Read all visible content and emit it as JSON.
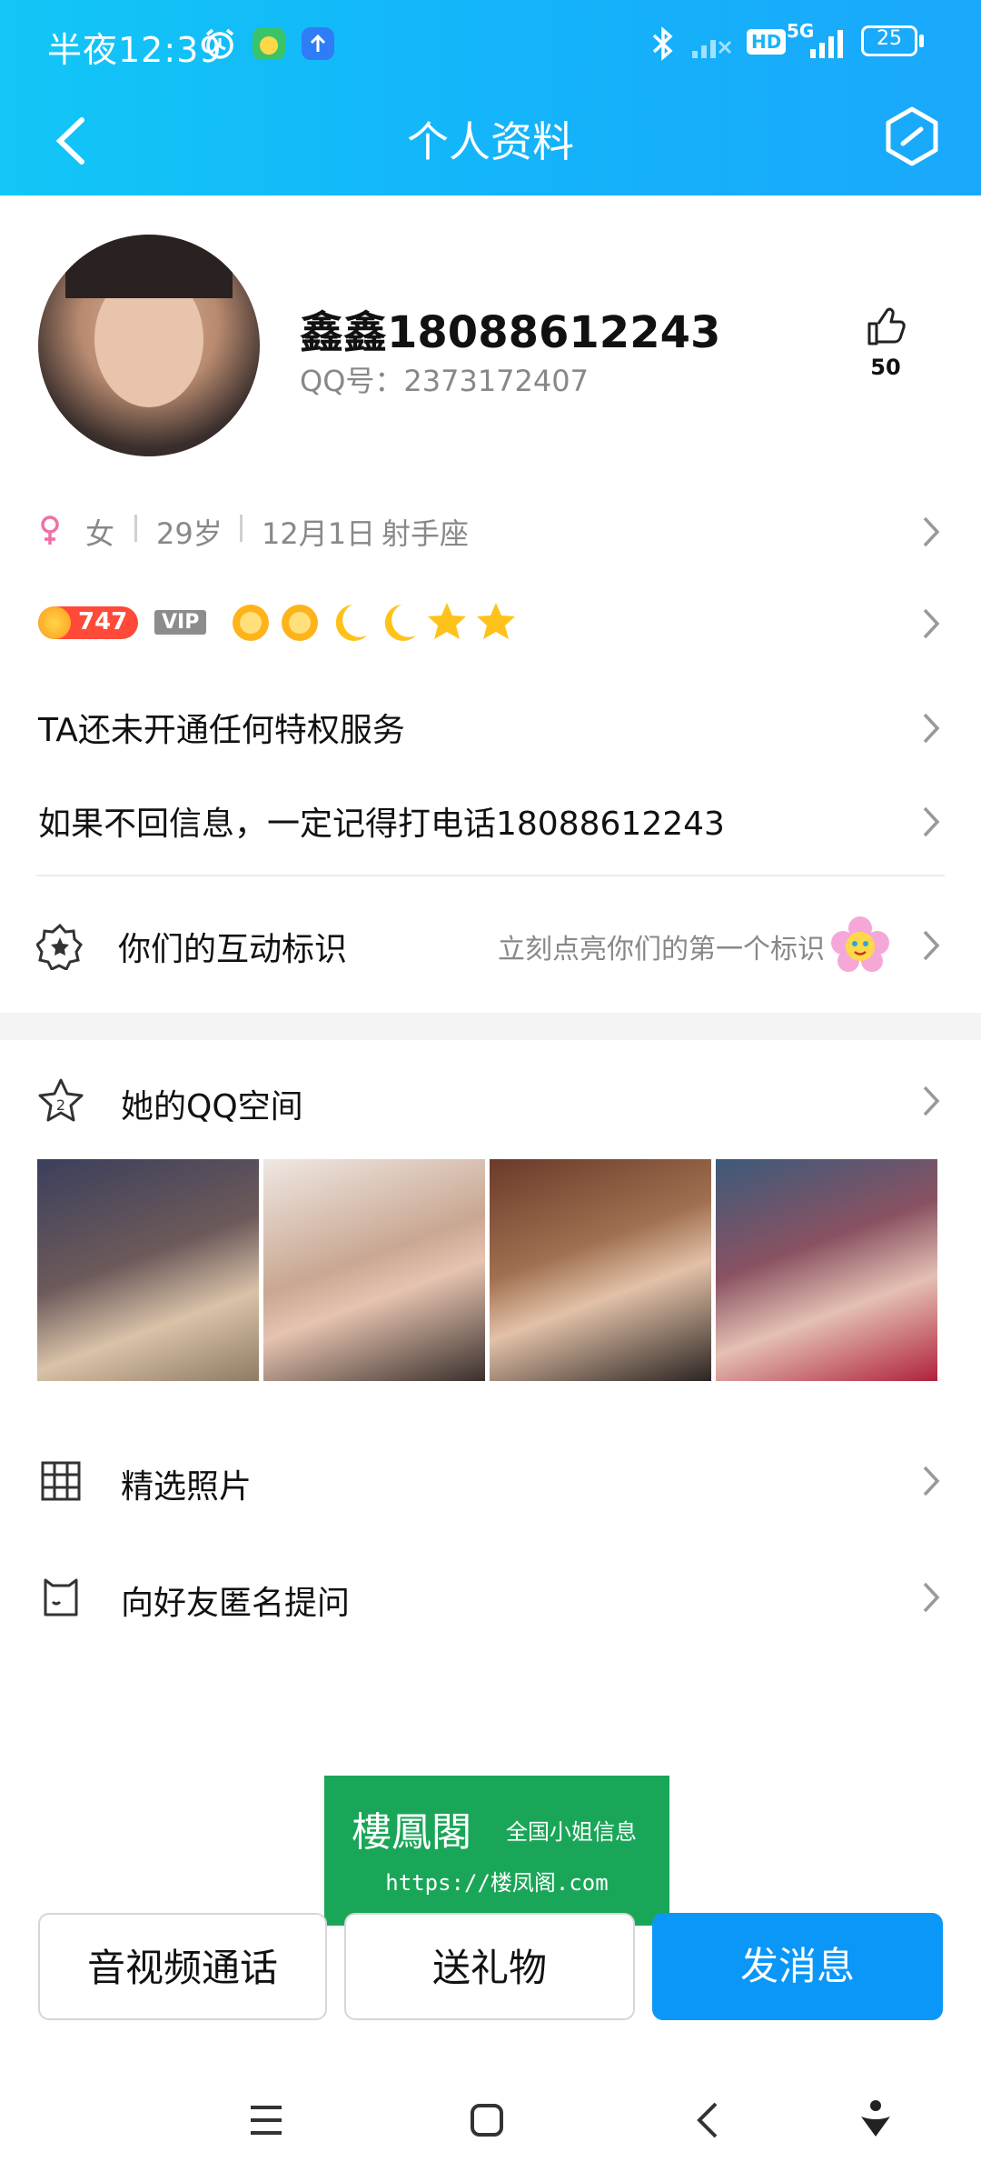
{
  "status_bar": {
    "time": "半夜12:39",
    "battery": "25",
    "network": "5G",
    "hd": "HD"
  },
  "nav": {
    "title": "个人资料"
  },
  "profile": {
    "nickname": "鑫鑫18088612243",
    "qq_number": "QQ号：2373172407",
    "likes": "50"
  },
  "info": {
    "gender": "女",
    "age": "29岁",
    "birthday": "12月1日",
    "zodiac": "射手座"
  },
  "level": {
    "points": "747",
    "vip": "VIP"
  },
  "rows": {
    "privilege": "TA还未开通任何特权服务",
    "signature": "如果不回信息，一定记得打电话18088612243"
  },
  "interaction": {
    "label": "你们的互动标识",
    "hint": "立刻点亮你们的第一个标识"
  },
  "qzone": {
    "label": "她的QQ空间"
  },
  "menu": {
    "photos": "精选照片",
    "ask": "向好友匿名提问"
  },
  "watermark": {
    "title": "樓鳳閣",
    "subtitle": "全国小姐信息",
    "url": "https://楼凤阁.com"
  },
  "actions": {
    "call": "音视频通话",
    "gift": "送礼物",
    "message": "发消息"
  },
  "colors": {
    "header_start": "#12c6f7",
    "header_end": "#1aa8fb",
    "primary": "#0a97f7",
    "watermark": "#1aa658"
  }
}
